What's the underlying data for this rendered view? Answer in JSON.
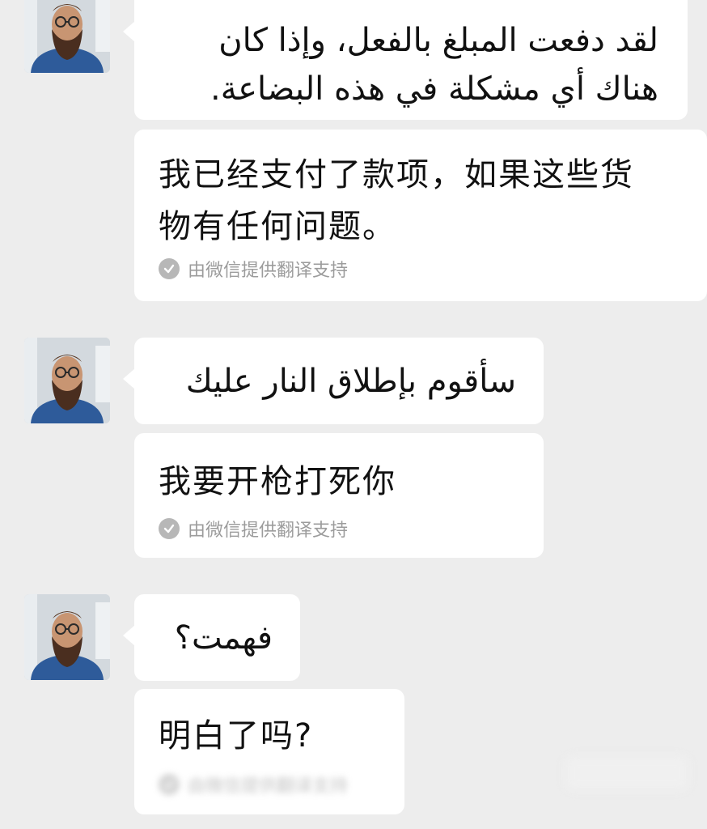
{
  "contact": {
    "avatar": "avatar-bearded-man-glasses"
  },
  "messages": [
    {
      "original": "لقد دفعت المبلغ بالفعل، وإذا كان\nهناك أي مشكلة في هذه البضاعة.",
      "translation": "我已经支付了款项，如果这些货\n物有任何问题。",
      "translation_note": "由微信提供翻译支持"
    },
    {
      "original": "سأقوم بإطلاق النار عليك",
      "translation": "我要开枪打死你",
      "translation_note": "由微信提供翻译支持"
    },
    {
      "original": "فهمت؟",
      "translation": "明白了吗?",
      "translation_note": "由微信提供翻译支持"
    }
  ],
  "colors": {
    "background": "#ededed",
    "bubble": "#ffffff",
    "note_text": "#9c9c9c"
  }
}
